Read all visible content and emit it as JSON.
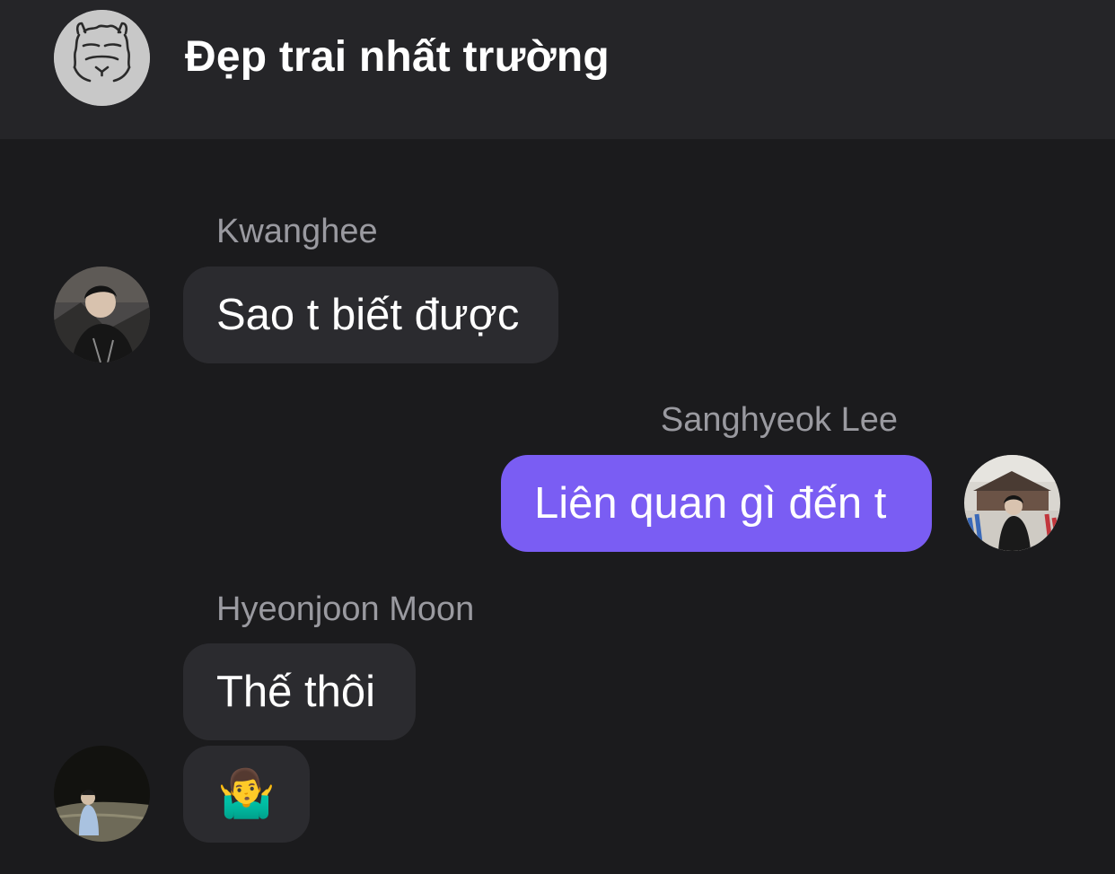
{
  "header": {
    "title": "Đẹp trai nhất trường",
    "avatar_icon": "alpaca-icon"
  },
  "messages": [
    {
      "sender": "Kwanghee",
      "text": "Sao t biết được",
      "direction": "incoming"
    },
    {
      "sender": "Sanghyeok Lee",
      "text": "Liên quan gì đến t",
      "direction": "outgoing"
    },
    {
      "sender": "Hyeonjoon Moon",
      "text": "Thế thôi",
      "direction": "incoming"
    },
    {
      "sender": "Hyeonjoon Moon",
      "text": "🤷‍♂️",
      "direction": "incoming"
    }
  ],
  "colors": {
    "background": "#1b1b1d",
    "header": "#252528",
    "incoming_bubble": "#2b2b2f",
    "outgoing_bubble": "#7a5df3",
    "sender_name": "#9a9aa0"
  }
}
